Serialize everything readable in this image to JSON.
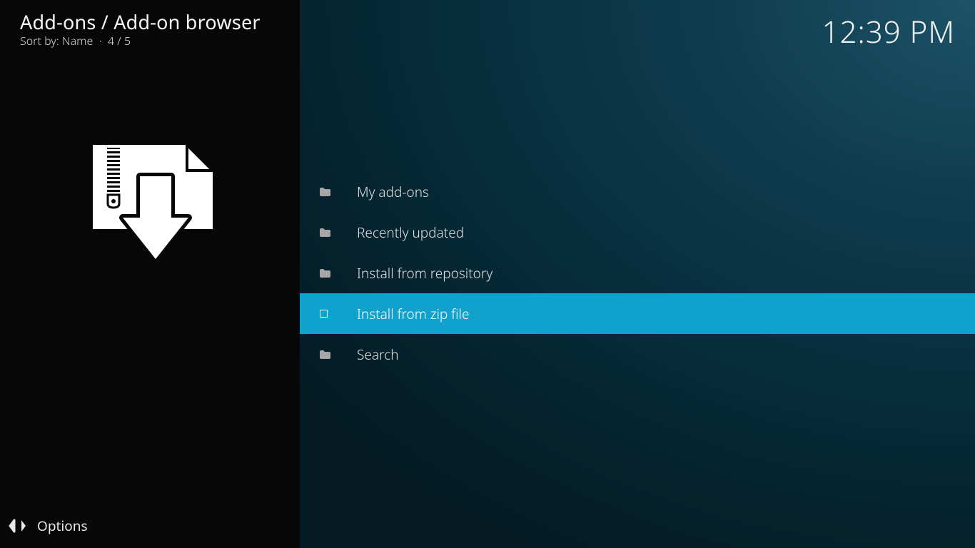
{
  "header": {
    "breadcrumb": "Add-ons / Add-on browser",
    "sort_label": "Sort by: Name",
    "separator": "·",
    "position": "4 / 5",
    "clock": "12:39 PM"
  },
  "menu": {
    "items": [
      {
        "label": "My add-ons",
        "icon": "folder",
        "selected": false
      },
      {
        "label": "Recently updated",
        "icon": "folder",
        "selected": false
      },
      {
        "label": "Install from repository",
        "icon": "folder",
        "selected": false
      },
      {
        "label": "Install from zip file",
        "icon": "zip",
        "selected": true
      },
      {
        "label": "Search",
        "icon": "folder",
        "selected": false
      }
    ]
  },
  "footer": {
    "options_label": "Options"
  }
}
